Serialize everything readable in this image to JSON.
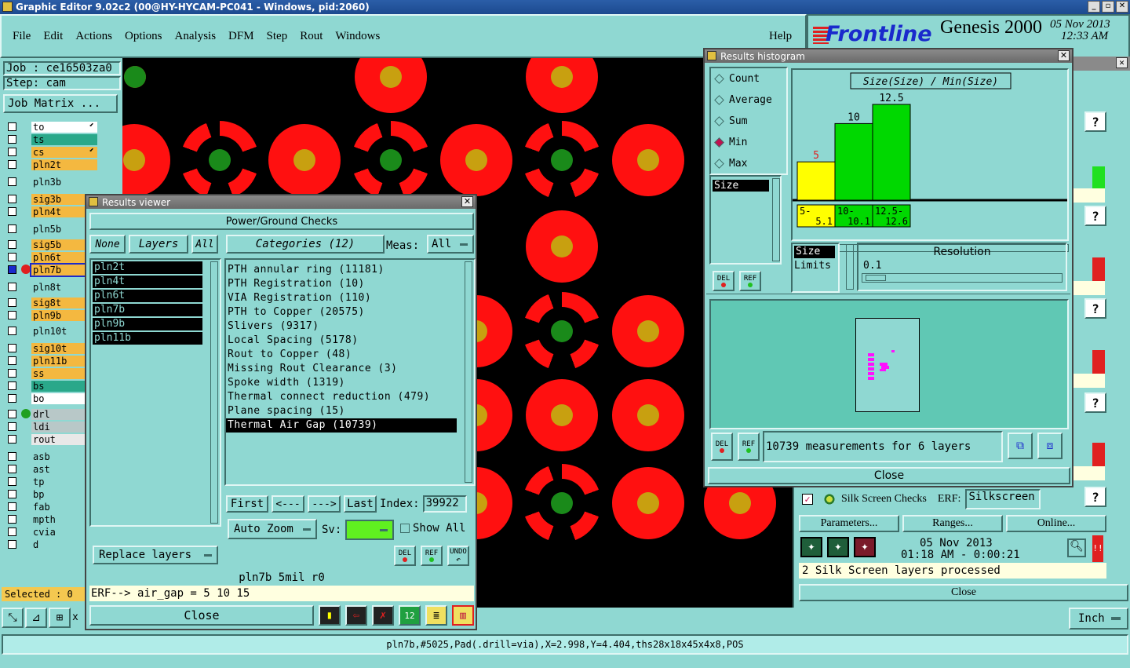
{
  "app": {
    "title": "Graphic Editor 9.02c2 (00@HY-HYCAM-PC041 - Windows, pid:2060)",
    "brand": "Frontline",
    "product": "Genesis 2000",
    "date": "05 Nov 2013",
    "time": "12:33 AM"
  },
  "menu": [
    "File",
    "Edit",
    "Actions",
    "Options",
    "Analysis",
    "DFM",
    "Step",
    "Rout",
    "Windows"
  ],
  "help": "Help",
  "job": {
    "job": "Job : ce16503za0",
    "step": "Step: cam",
    "matrix": "Job Matrix ..."
  },
  "layers": [
    {
      "name": "to",
      "color": "#ffffff",
      "arrow": true
    },
    {
      "name": "ts",
      "color": "#2aa88a"
    },
    {
      "name": "cs",
      "color": "#f4b840",
      "arrow": true
    },
    {
      "name": "pln2t",
      "color": "#f4b840"
    },
    {
      "name": "pln3b",
      "color": "#8fd8d2"
    },
    {
      "name": "sig3b",
      "color": "#f4b840"
    },
    {
      "name": "pln4t",
      "color": "#f4b840"
    },
    {
      "name": "pln5b",
      "color": "#8fd8d2"
    },
    {
      "name": "sig5b",
      "color": "#f4b840"
    },
    {
      "name": "pln6t",
      "color": "#f4b840"
    },
    {
      "name": "pln7b",
      "color": "#f4b840",
      "active": true
    },
    {
      "name": "pln8t",
      "color": "#8fd8d2"
    },
    {
      "name": "sig8t",
      "color": "#f4b840"
    },
    {
      "name": "pln9b",
      "color": "#f4b840"
    },
    {
      "name": "pln10t",
      "color": "#8fd8d2"
    },
    {
      "name": "sig10t",
      "color": "#f4b840"
    },
    {
      "name": "pln11b",
      "color": "#f4b840"
    },
    {
      "name": "ss",
      "color": "#f4b840"
    },
    {
      "name": "bs",
      "color": "#2aa88a"
    },
    {
      "name": "bo",
      "color": "#ffffff"
    },
    {
      "name": "drl",
      "color": "#b8c8c8",
      "dot": true
    },
    {
      "name": "ldi",
      "color": "#b8c8c8"
    },
    {
      "name": "rout",
      "color": "#e8e8e8"
    },
    {
      "name": "asb",
      "color": "#8fd8d2"
    },
    {
      "name": "ast",
      "color": "#8fd8d2"
    },
    {
      "name": "tp",
      "color": "#8fd8d2"
    },
    {
      "name": "bp",
      "color": "#8fd8d2"
    },
    {
      "name": "fab",
      "color": "#8fd8d2"
    },
    {
      "name": "mpth",
      "color": "#8fd8d2"
    },
    {
      "name": "cvia",
      "color": "#8fd8d2"
    },
    {
      "name": "d",
      "color": "#8fd8d2"
    }
  ],
  "selected": "Selected : 0",
  "units": "Inch",
  "status": "pln7b,#5025,Pad(.drill=via),X=2.998,Y=4.404,ths28x18x45x4x8,POS",
  "viewer": {
    "title": "Results viewer",
    "header": "Power/Ground Checks",
    "none": "None",
    "layers_label": "Layers",
    "all": "All",
    "categories": "Categories (12)",
    "meas": "Meas:",
    "meas_val": "All",
    "layer_list": [
      "pln2t",
      "pln4t",
      "pln6t",
      "pln7b",
      "pln9b",
      "pln11b"
    ],
    "cat_list": [
      "PTH annular ring (11181)",
      "PTH Registration (10)",
      "VIA Registration (110)",
      "PTH to Copper (20575)",
      "Slivers (9317)",
      "Local Spacing (5178)",
      "Rout to Copper (48)",
      "Missing Rout Clearance (3)",
      "Spoke width (1319)",
      "Thermal connect reduction (479)",
      "Plane spacing (15)",
      "Thermal Air Gap (10739)"
    ],
    "first": "First",
    "prev": "<---",
    "next": "--->",
    "last": "Last",
    "index_label": "Index:",
    "index": "39922",
    "auto_zoom": "Auto Zoom",
    "sv": "Sv:",
    "show_all": "Show All",
    "replace": "Replace layers",
    "info": "pln7b 5mil  r0",
    "erf": "ERF--> air_gap = 5 10 15",
    "close": "Close",
    "del": "DEL",
    "ref": "REF",
    "undo": "UNDO"
  },
  "histogram": {
    "title": "Results histogram",
    "options": [
      "Count",
      "Average",
      "Sum",
      "Min",
      "Max"
    ],
    "selected": "Min",
    "size_item": "Size",
    "chart_title": "Size(Size) / Min(Size)",
    "size_label": "Size",
    "limits_label": "Limits",
    "resolution_label": "Resolution",
    "resolution": "0.1",
    "summary": "10739 measurements for 6 layers",
    "close": "Close"
  },
  "chart_data": {
    "type": "bar",
    "title": "Size(Size) / Min(Size)",
    "categories": [
      "5-5.1",
      "10-10.1",
      "12.5-12.6"
    ],
    "values": [
      5,
      10,
      12.5
    ],
    "colors": [
      "#ffff00",
      "#00d800",
      "#00d800"
    ]
  },
  "silk": {
    "label": "Silk Screen Checks",
    "erf": "ERF:",
    "erf_val": "Silkscreen",
    "params": "Parameters...",
    "ranges": "Ranges...",
    "online": "Online...",
    "date": "05 Nov 2013",
    "time": "01:18 AM - 0:00:21",
    "msg": "2 Silk Screen layers processed",
    "close": "Close"
  }
}
